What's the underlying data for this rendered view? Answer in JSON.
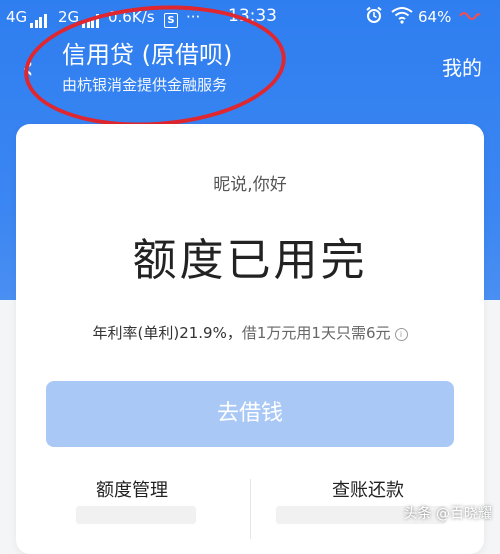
{
  "status_bar": {
    "network1": "4G",
    "network2": "2G",
    "speed": "0.6K/s",
    "s_icon": "S",
    "dots": "···",
    "time": "13:33",
    "battery": "64%",
    "icons": [
      "signal-icon",
      "alarm-icon",
      "wifi-icon",
      "battery-icon"
    ]
  },
  "header": {
    "back_icon": "‹",
    "title": "信用贷 (原借呗)",
    "subtitle": "由杭银消金提供金融服务",
    "my_link": "我的"
  },
  "card": {
    "greeting": "昵说,你好",
    "status": "额度已用完",
    "rate": "年利率(单利)21.9%，",
    "rate_info": "借1万元用1天只需6元",
    "info_icon": "i",
    "borrow_button": "去借钱",
    "credit_management": "额度管理",
    "bill_repayment": "查账还款"
  },
  "watermark": "头条 @百晓耀",
  "colors": {
    "brand_blue": "#2f7ef0",
    "button_disabled": "#a9c8f6",
    "annotation_red": "#e0262e"
  }
}
